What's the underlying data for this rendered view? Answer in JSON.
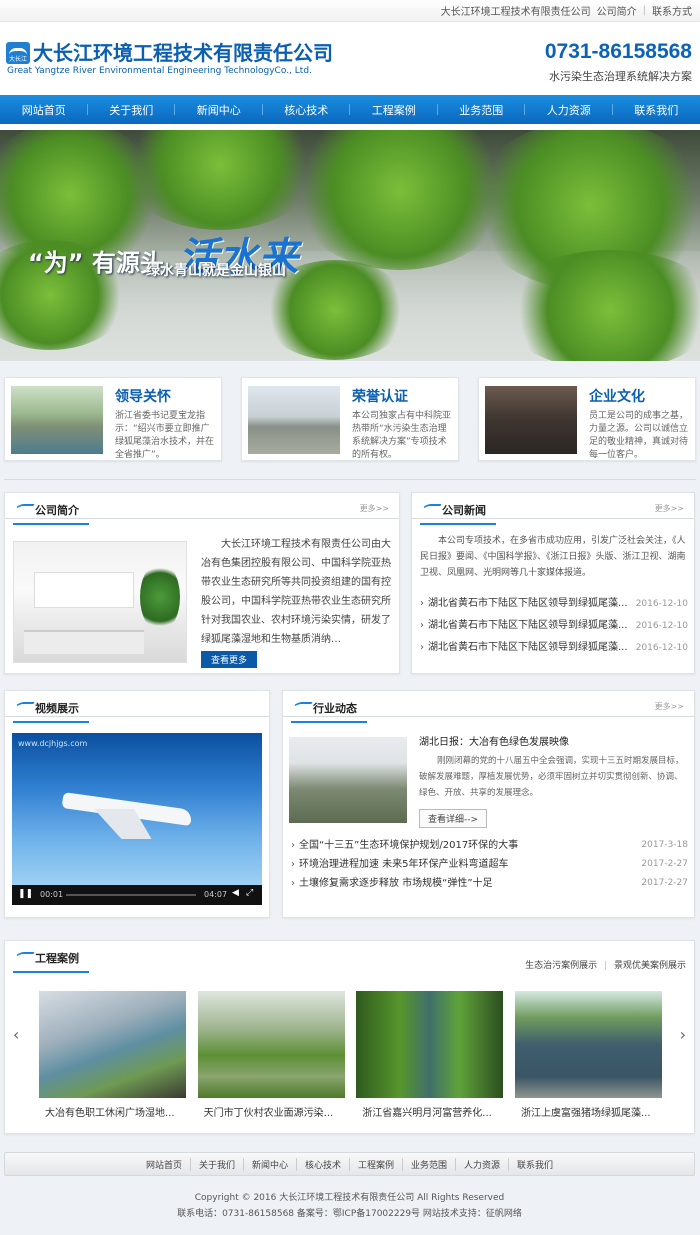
{
  "topbar": {
    "company": "大长江环境工程技术有限责任公司",
    "intro": "公司简介",
    "sep": "|",
    "contact": "联系方式"
  },
  "header": {
    "logo_cn": "大长江环境工程技术有限责任公司",
    "logo_en": "Great Yangtze River Environmental Engineering TechnologyCo., Ltd.",
    "logo_mark": "大长江",
    "phone": "0731-86158568",
    "slogan": "水污染生态治理系统解决方案"
  },
  "nav": [
    "网站首页",
    "关于我们",
    "新闻中心",
    "核心技术",
    "工程案例",
    "业务范围",
    "人力资源",
    "联系我们"
  ],
  "banner": {
    "quote_open": "“为”",
    "line1": "有源头",
    "line1_big": "活水来",
    "line2": "绿水青山就是金山银山"
  },
  "features": [
    {
      "title": "领导关怀",
      "text": "浙江省委书记夏宝龙指示：“绍兴市要立即推广绿狐尾藻治水技术，并在全省推广”。"
    },
    {
      "title": "荣誉认证",
      "text": "本公司独家占有中科院亚热带所“水污染生态治理系统解决方案”专项技术的所有权。"
    },
    {
      "title": "企业文化",
      "text": "员工是公司的成事之基，力量之源。公司以诚信立足的敬业精神，真诚对待每一位客户。"
    }
  ],
  "about": {
    "title": "公司简介",
    "more": "更多>>",
    "text": "大长江环境工程技术有限责任公司由大冶有色集团控股有限公司、中国科学院亚热带农业生态研究所等共同投资组建的国有控股公司，中国科学院亚热带农业生态研究所针对我国农业、农村环境污染实情，研发了绿狐尾藻湿地和生物基质消纳…",
    "button": "查看更多"
  },
  "company_news": {
    "title": "公司新闻",
    "more": "更多>>",
    "intro": "本公司专项技术，在多省市成功应用，引发广泛社会关注，《人民日报》要闻、《中国科学报》、《浙江日报》头版、浙江卫视、湖南卫视、凤凰网、光明网等几十家媒体报道。",
    "items": [
      {
        "title": "湖北省黄石市下陆区下陆区领导到绿狐尾藻...",
        "date": "2016-12-10"
      },
      {
        "title": "湖北省黄石市下陆区下陆区领导到绿狐尾藻...",
        "date": "2016-12-10"
      },
      {
        "title": "湖北省黄石市下陆区下陆区领导到绿狐尾藻...",
        "date": "2016-12-10"
      }
    ]
  },
  "video": {
    "title": "视频展示",
    "watermark": "www.dcjhjgs.com",
    "time_cur": "00:01",
    "time_total": "04:07"
  },
  "industry": {
    "title": "行业动态",
    "more": "更多>>",
    "headline": "湖北日报：大冶有色绿色发展映像",
    "summary": "刚刚闭幕的党的十八届五中全会强调，实现十三五时期发展目标，破解发展难题，厚植发展优势，必须牢固树立并切实贯彻创新、协调、绿色、开放、共享的发展理念。",
    "button": "查看详细-->",
    "items": [
      {
        "title": "全国“十三五”生态环境保护规划/2017环保的大事",
        "date": "2017-3-18"
      },
      {
        "title": "环境治理进程加速  未来5年环保产业料弯道超车",
        "date": "2017-2-27"
      },
      {
        "title": "土壤修复需求逐步释放  市场规模“弹性”十足",
        "date": "2017-2-27"
      }
    ]
  },
  "cases": {
    "title": "工程案例",
    "link1": "生态治污案例展示",
    "sep": "|",
    "link2": "景观优美案例展示",
    "items": [
      {
        "caption": "大冶有色职工休闲广场湿地..."
      },
      {
        "caption": "天门市丁伙村农业面源污染..."
      },
      {
        "caption": "浙江省嘉兴明月河富营养化..."
      },
      {
        "caption": "浙江上虞富强猪场绿狐尾藻..."
      }
    ]
  },
  "footer": {
    "nav": [
      "网站首页",
      "关于我们",
      "新闻中心",
      "核心技术",
      "工程案例",
      "业务范围",
      "人力资源",
      "联系我们"
    ],
    "copyright": "Copyright © 2016 大长江环境工程技术有限责任公司 All Rights Reserved",
    "contact": "联系电话：0731-86158568  备案号：鄂ICP备17002229号  网站技术支持：征帆网络"
  }
}
